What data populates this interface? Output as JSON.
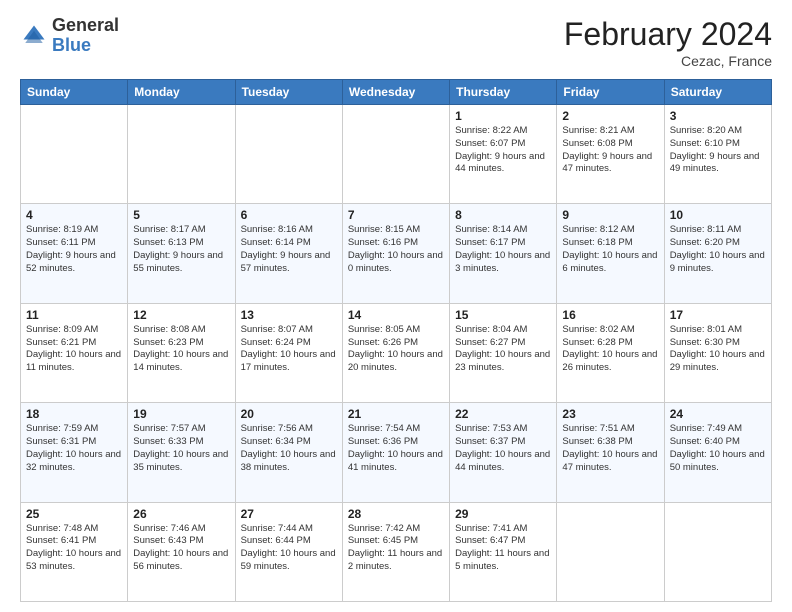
{
  "header": {
    "logo_general": "General",
    "logo_blue": "Blue",
    "month_title": "February 2024",
    "location": "Cezac, France"
  },
  "days_of_week": [
    "Sunday",
    "Monday",
    "Tuesday",
    "Wednesday",
    "Thursday",
    "Friday",
    "Saturday"
  ],
  "weeks": [
    [
      {
        "day": "",
        "info": ""
      },
      {
        "day": "",
        "info": ""
      },
      {
        "day": "",
        "info": ""
      },
      {
        "day": "",
        "info": ""
      },
      {
        "day": "1",
        "info": "Sunrise: 8:22 AM\nSunset: 6:07 PM\nDaylight: 9 hours and 44 minutes."
      },
      {
        "day": "2",
        "info": "Sunrise: 8:21 AM\nSunset: 6:08 PM\nDaylight: 9 hours and 47 minutes."
      },
      {
        "day": "3",
        "info": "Sunrise: 8:20 AM\nSunset: 6:10 PM\nDaylight: 9 hours and 49 minutes."
      }
    ],
    [
      {
        "day": "4",
        "info": "Sunrise: 8:19 AM\nSunset: 6:11 PM\nDaylight: 9 hours and 52 minutes."
      },
      {
        "day": "5",
        "info": "Sunrise: 8:17 AM\nSunset: 6:13 PM\nDaylight: 9 hours and 55 minutes."
      },
      {
        "day": "6",
        "info": "Sunrise: 8:16 AM\nSunset: 6:14 PM\nDaylight: 9 hours and 57 minutes."
      },
      {
        "day": "7",
        "info": "Sunrise: 8:15 AM\nSunset: 6:16 PM\nDaylight: 10 hours and 0 minutes."
      },
      {
        "day": "8",
        "info": "Sunrise: 8:14 AM\nSunset: 6:17 PM\nDaylight: 10 hours and 3 minutes."
      },
      {
        "day": "9",
        "info": "Sunrise: 8:12 AM\nSunset: 6:18 PM\nDaylight: 10 hours and 6 minutes."
      },
      {
        "day": "10",
        "info": "Sunrise: 8:11 AM\nSunset: 6:20 PM\nDaylight: 10 hours and 9 minutes."
      }
    ],
    [
      {
        "day": "11",
        "info": "Sunrise: 8:09 AM\nSunset: 6:21 PM\nDaylight: 10 hours and 11 minutes."
      },
      {
        "day": "12",
        "info": "Sunrise: 8:08 AM\nSunset: 6:23 PM\nDaylight: 10 hours and 14 minutes."
      },
      {
        "day": "13",
        "info": "Sunrise: 8:07 AM\nSunset: 6:24 PM\nDaylight: 10 hours and 17 minutes."
      },
      {
        "day": "14",
        "info": "Sunrise: 8:05 AM\nSunset: 6:26 PM\nDaylight: 10 hours and 20 minutes."
      },
      {
        "day": "15",
        "info": "Sunrise: 8:04 AM\nSunset: 6:27 PM\nDaylight: 10 hours and 23 minutes."
      },
      {
        "day": "16",
        "info": "Sunrise: 8:02 AM\nSunset: 6:28 PM\nDaylight: 10 hours and 26 minutes."
      },
      {
        "day": "17",
        "info": "Sunrise: 8:01 AM\nSunset: 6:30 PM\nDaylight: 10 hours and 29 minutes."
      }
    ],
    [
      {
        "day": "18",
        "info": "Sunrise: 7:59 AM\nSunset: 6:31 PM\nDaylight: 10 hours and 32 minutes."
      },
      {
        "day": "19",
        "info": "Sunrise: 7:57 AM\nSunset: 6:33 PM\nDaylight: 10 hours and 35 minutes."
      },
      {
        "day": "20",
        "info": "Sunrise: 7:56 AM\nSunset: 6:34 PM\nDaylight: 10 hours and 38 minutes."
      },
      {
        "day": "21",
        "info": "Sunrise: 7:54 AM\nSunset: 6:36 PM\nDaylight: 10 hours and 41 minutes."
      },
      {
        "day": "22",
        "info": "Sunrise: 7:53 AM\nSunset: 6:37 PM\nDaylight: 10 hours and 44 minutes."
      },
      {
        "day": "23",
        "info": "Sunrise: 7:51 AM\nSunset: 6:38 PM\nDaylight: 10 hours and 47 minutes."
      },
      {
        "day": "24",
        "info": "Sunrise: 7:49 AM\nSunset: 6:40 PM\nDaylight: 10 hours and 50 minutes."
      }
    ],
    [
      {
        "day": "25",
        "info": "Sunrise: 7:48 AM\nSunset: 6:41 PM\nDaylight: 10 hours and 53 minutes."
      },
      {
        "day": "26",
        "info": "Sunrise: 7:46 AM\nSunset: 6:43 PM\nDaylight: 10 hours and 56 minutes."
      },
      {
        "day": "27",
        "info": "Sunrise: 7:44 AM\nSunset: 6:44 PM\nDaylight: 10 hours and 59 minutes."
      },
      {
        "day": "28",
        "info": "Sunrise: 7:42 AM\nSunset: 6:45 PM\nDaylight: 11 hours and 2 minutes."
      },
      {
        "day": "29",
        "info": "Sunrise: 7:41 AM\nSunset: 6:47 PM\nDaylight: 11 hours and 5 minutes."
      },
      {
        "day": "",
        "info": ""
      },
      {
        "day": "",
        "info": ""
      }
    ]
  ]
}
